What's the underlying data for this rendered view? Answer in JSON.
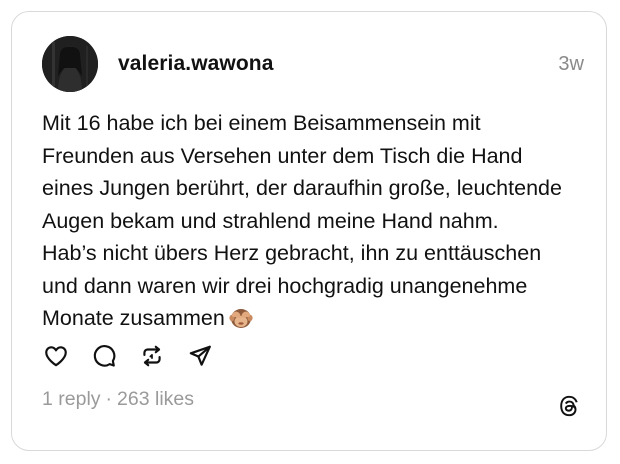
{
  "post": {
    "username": "valeria.wawona",
    "timestamp": "3w",
    "text_lines": [
      "Mit 16 habe ich bei einem Beisammensein mit",
      "Freunden aus Versehen unter dem Tisch die Hand",
      "eines Jungen berührt, der daraufhin große, leuchtende",
      "Augen bekam und strahlend meine Hand nahm.",
      "Hab’s nicht übers Herz gebracht, ihn zu enttäuschen",
      "und dann waren wir drei hochgradig unangenehme",
      "Monate zusammen"
    ],
    "emoji_icon": "see-no-evil-monkey-icon",
    "replies": "1 reply",
    "separator": "·",
    "likes": "263 likes"
  },
  "actions": {
    "like_icon": "heart-icon",
    "reply_icon": "comment-icon",
    "repost_icon": "repost-icon",
    "share_icon": "send-icon"
  },
  "brand": {
    "logo_icon": "threads-logo-icon"
  },
  "colors": {
    "text": "#111111",
    "muted": "#8a8a8a",
    "border": "#d9d9d9"
  }
}
